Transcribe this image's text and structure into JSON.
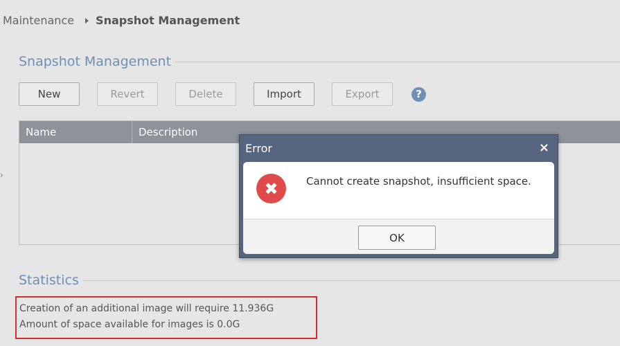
{
  "breadcrumb": {
    "parent": "Maintenance",
    "current": "Snapshot Management"
  },
  "snapshot_section": {
    "title": "Snapshot Management",
    "buttons": {
      "new": "New",
      "revert": "Revert",
      "delete": "Delete",
      "import": "Import",
      "export": "Export"
    },
    "help_glyph": "?",
    "table": {
      "columns": [
        "Name",
        "Description"
      ]
    }
  },
  "statistics": {
    "title": "Statistics",
    "line1": "Creation of an additional image will require 11.936G",
    "line2": "Amount of space available for images is 0.0G"
  },
  "dialog": {
    "title": "Error",
    "close_glyph": "×",
    "icon": "error-circle-icon",
    "icon_glyph": "✖",
    "message": "Cannot create snapshot, insufficient space.",
    "ok_label": "OK"
  },
  "colors": {
    "accent": "#6f8fb5",
    "dialog_header": "#56657f",
    "error": "#e04a4a",
    "highlight_border": "#d82c2c"
  }
}
